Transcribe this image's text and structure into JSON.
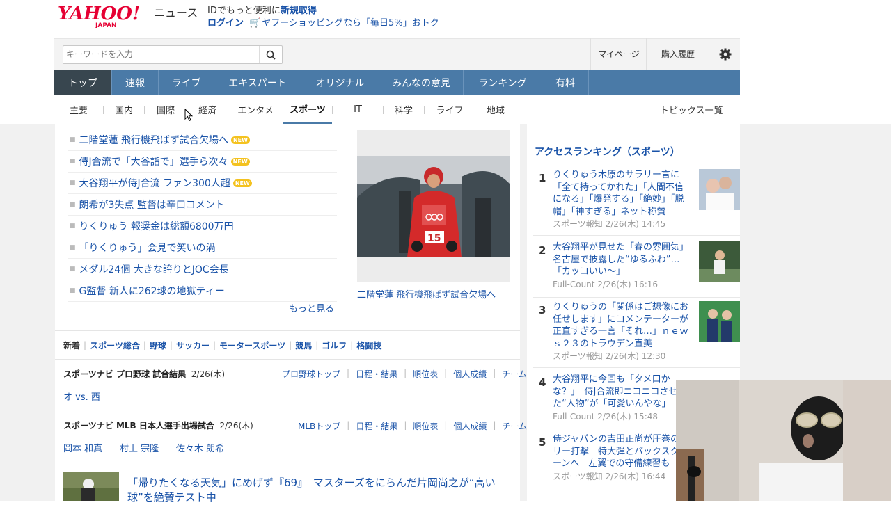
{
  "header": {
    "logo_text": "YAHOO! JAPAN",
    "service_name": "ニュース",
    "promo_line1_prefix": "IDでもっと便利に",
    "promo_line1_link": "新規取得",
    "login_label": "ログイン",
    "shopping_promo": "ヤフーショッピングなら「毎日5%」おトク"
  },
  "search": {
    "placeholder": "キーワードを入力",
    "mypage_label": "マイページ",
    "history_label": "購入履歴"
  },
  "main_nav": [
    {
      "label": "トップ",
      "active": true
    },
    {
      "label": "速報"
    },
    {
      "label": "ライブ"
    },
    {
      "label": "エキスパート"
    },
    {
      "label": "オリジナル"
    },
    {
      "label": "みんなの意見"
    },
    {
      "label": "ランキング"
    },
    {
      "label": "有料"
    }
  ],
  "sub_nav": [
    {
      "label": "主要"
    },
    {
      "label": "国内"
    },
    {
      "label": "国際"
    },
    {
      "label": "経済"
    },
    {
      "label": "エンタメ"
    },
    {
      "label": "スポーツ",
      "active": true
    },
    {
      "label": "IT"
    },
    {
      "label": "科学"
    },
    {
      "label": "ライフ"
    },
    {
      "label": "地域"
    }
  ],
  "topics_link": "トピックス一覧",
  "headlines": [
    {
      "text": "二階堂蓮 飛行機飛ばず試合欠場へ",
      "new": true,
      "new_label": "NEW"
    },
    {
      "text": "侍J合流で「大谷詣で」選手ら次々",
      "new": true,
      "new_label": "NEW"
    },
    {
      "text": "大谷翔平が侍J合流 ファン300人超",
      "new": true,
      "new_label": "NEW"
    },
    {
      "text": "朗希が3失点 監督は辛口コメント"
    },
    {
      "text": "りくりゅう 報奨金は総額6800万円"
    },
    {
      "text": "「りくりゅう」会見で笑いの渦"
    },
    {
      "text": "メダル24個 大きな誇りとJOC会長"
    },
    {
      "text": "G監督 新人に262球の地獄ティー"
    }
  ],
  "more_label": "もっと見る",
  "feature_caption": "二階堂蓮 飛行機飛ばず試合欠場へ",
  "sports_tabs": [
    "新着",
    "スポーツ総合",
    "野球",
    "サッカー",
    "モータースポーツ",
    "競馬",
    "ゴルフ",
    "格闘技"
  ],
  "navi_blocks": [
    {
      "title": "スポーツナビ プロ野球 試合結果",
      "date": "2/26(木)",
      "links": [
        "プロ野球トップ",
        "日程・結果",
        "順位表",
        "個人成績",
        "チーム"
      ],
      "results": [
        "オ vs. 西"
      ]
    },
    {
      "title": "スポーツナビ MLB 日本人選手出場試合",
      "date": "2/26(木)",
      "links": [
        "MLBトップ",
        "日程・結果",
        "順位表",
        "個人成績",
        "チーム"
      ],
      "results": [
        "岡本 和真",
        "村上 宗隆",
        "佐々木 朗希"
      ]
    }
  ],
  "news_item": {
    "text": "「帰りたくなる天気」にめげず『69』　マスターズをにらんだ片岡尚之が“高い球”を絶賛テスト中"
  },
  "ranking": {
    "heading": "アクセスランキング（スポーツ）",
    "items": [
      {
        "rank": "1",
        "title": "りくりゅう木原のサラリー言に「全て持ってかれた」「人間不信になる」「爆発する」「絶妙」「脱帽」「神すぎる」ネット称賛",
        "source": "スポーツ報知 2/26(木) 14:45"
      },
      {
        "rank": "2",
        "title": "大谷翔平が見せた「春の雰囲気」名古屋で披露した“ゆるふわ”…「カッコいい～」",
        "source": "Full-Count 2/26(木) 16:16"
      },
      {
        "rank": "3",
        "title": "りくりゅうの「関係はご想像にお任せします」にコメンテーターが正直すぎる一言「それ…」ｎｅｗｓ２３のトラウデン直美",
        "source": "スポーツ報知 2/26(木) 12:30"
      },
      {
        "rank": "4",
        "title": "大谷翔平に今回も「タメ口かな？」　侍J合流即ニコニコさせた“人物”が「可愛いんやな」",
        "source": "Full-Count 2/26(木) 15:48"
      },
      {
        "rank": "5",
        "title": "侍ジャパンの吉田正尚が圧巻のフリー打撃　特大弾とバックスクリーンへ　左翼での守備練習も",
        "source": "スポーツ報知 2/26(木) 16:44"
      }
    ]
  }
}
